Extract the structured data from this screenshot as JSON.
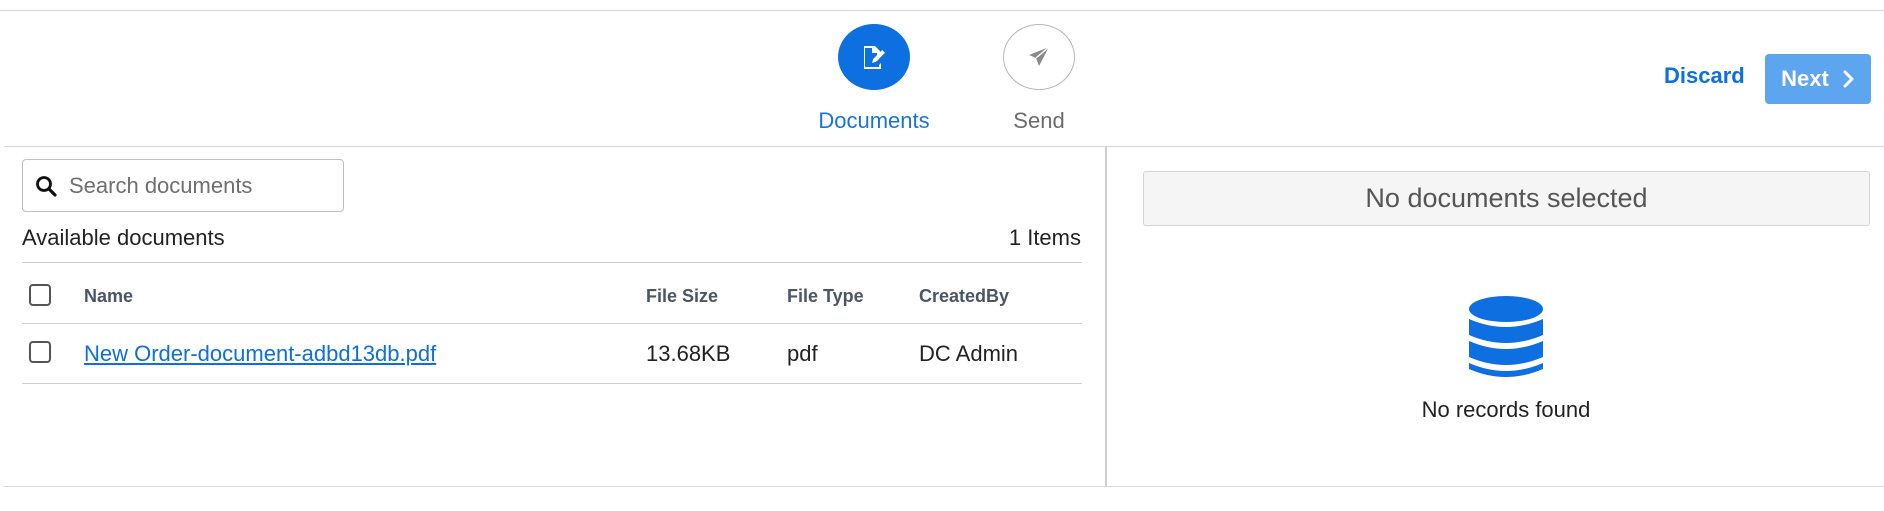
{
  "stepper": {
    "steps": [
      {
        "label": "Documents",
        "icon": "edit-document-icon",
        "active": true
      },
      {
        "label": "Send",
        "icon": "paper-plane-icon",
        "active": false
      }
    ]
  },
  "actions": {
    "discard_label": "Discard",
    "next_label": "Next"
  },
  "search": {
    "placeholder": "Search documents",
    "value": ""
  },
  "available": {
    "title": "Available documents",
    "count": "1 Items",
    "columns": [
      "Name",
      "File Size",
      "File Type",
      "CreatedBy"
    ],
    "rows": [
      {
        "name": "New Order-document-adbd13db.pdf",
        "size": "13.68KB",
        "type": "pdf",
        "created_by": "DC Admin",
        "checked": false
      }
    ]
  },
  "selected": {
    "header": "No documents selected",
    "empty_text": "No records found",
    "empty_icon": "database-icon"
  },
  "colors": {
    "primary": "#0d6fe0",
    "next_button": "#5ea5f0",
    "border": "#d6d6d6"
  }
}
